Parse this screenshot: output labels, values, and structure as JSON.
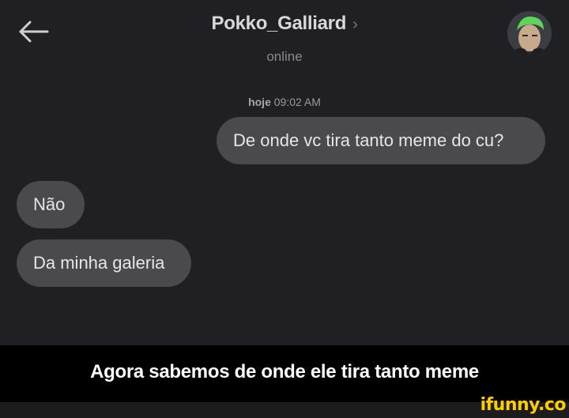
{
  "header": {
    "contact_name": "Pokko_Galliard",
    "chevron": "›",
    "status": "online",
    "back_icon": "arrow-left-icon",
    "avatar_icon": "contact-avatar"
  },
  "conversation": {
    "timestamp_day": "hoje",
    "timestamp_time": "09:02 AM",
    "messages": [
      {
        "direction": "out",
        "text": "De onde vc tira tanto meme do cu?"
      },
      {
        "direction": "in",
        "text": "Não"
      },
      {
        "direction": "in",
        "text": "Da minha galeria"
      }
    ]
  },
  "caption": {
    "text": "Agora sabemos de onde ele tira tanto meme"
  },
  "watermark": {
    "text": "ifunny.co"
  },
  "colors": {
    "background": "#202024",
    "bubble": "#4a4a4d",
    "caption_bar": "#000000",
    "watermark": "#ffcc00"
  }
}
